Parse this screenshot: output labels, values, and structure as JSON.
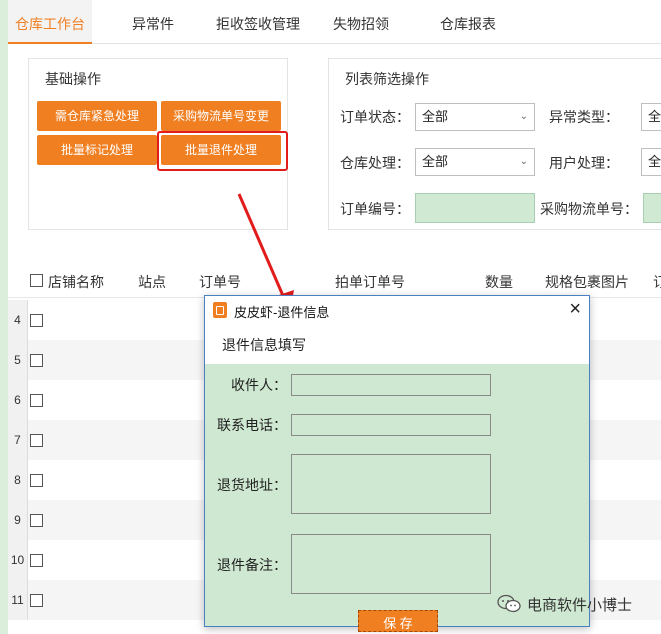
{
  "tabs": [
    {
      "label": "仓库工作台",
      "active": true
    },
    {
      "label": "异常件",
      "active": false
    },
    {
      "label": "拒收签收管理",
      "active": false
    },
    {
      "label": "失物招领",
      "active": false
    },
    {
      "label": "仓库报表",
      "active": false
    }
  ],
  "basic_ops": {
    "title": "基础操作",
    "buttons": [
      "需仓库紧急处理",
      "采购物流单号变更",
      "批量标记处理",
      "批量退件处理"
    ]
  },
  "filter": {
    "title": "列表筛选操作",
    "order_status_label": "订单状态：",
    "order_status_value": "全部",
    "exception_type_label": "异常类型：",
    "exception_type_value": "全",
    "warehouse_label": "仓库处理：",
    "warehouse_value": "全部",
    "user_label": "用户处理：",
    "user_value": "全",
    "order_no_label": "订单编号：",
    "purchase_no_label": "采购物流单号："
  },
  "table": {
    "headers": [
      "店铺名称",
      "站点",
      "订单号",
      "拍单订单号",
      "数量",
      "规格包裹图片",
      "订"
    ],
    "row_numbers": [
      "4",
      "5",
      "6",
      "7",
      "8",
      "9",
      "10",
      "11"
    ]
  },
  "dialog": {
    "title": "皮皮虾-退件信息",
    "close": "×",
    "section": "退件信息填写",
    "recipient_label": "收件人：",
    "phone_label": "联系电话：",
    "address_label": "退货地址：",
    "note_label": "退件备注：",
    "save_label": "保 存"
  },
  "watermark": "电商软件小博士",
  "colors": {
    "accent": "#f07f22",
    "highlight": "#e21b1b",
    "dialog_bg": "#cfe8d1"
  }
}
